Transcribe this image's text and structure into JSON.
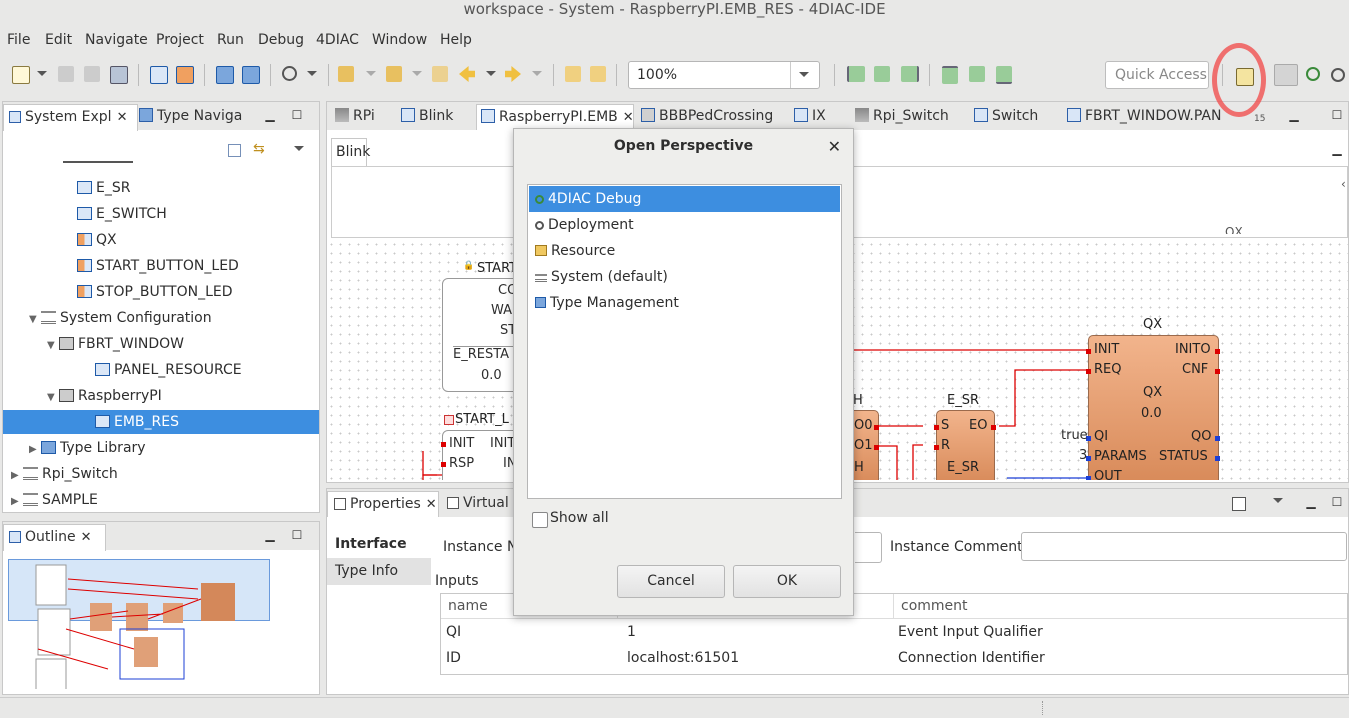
{
  "window": {
    "title": "workspace - System - RaspberryPI.EMB_RES - 4DIAC-IDE"
  },
  "menu": [
    "File",
    "Edit",
    "Navigate",
    "Project",
    "Run",
    "Debug",
    "4DIAC",
    "Window",
    "Help"
  ],
  "toolbar": {
    "zoom": "100%",
    "quick_access_placeholder": "Quick Access"
  },
  "left_panel": {
    "tabs": [
      {
        "label": "System Expl",
        "close": "✕"
      },
      {
        "label": "Type Naviga"
      }
    ],
    "tree": [
      {
        "label": "E_SR",
        "indent": 3,
        "icon": "fb"
      },
      {
        "label": "E_SWITCH",
        "indent": 3,
        "icon": "fb"
      },
      {
        "label": "QX",
        "indent": 3,
        "icon": "fbc"
      },
      {
        "label": "START_BUTTON_LED",
        "indent": 3,
        "icon": "fbc"
      },
      {
        "label": "STOP_BUTTON_LED",
        "indent": 3,
        "icon": "fbc"
      },
      {
        "label": "System Configuration",
        "indent": 1,
        "icon": "sys",
        "twisty": "▼"
      },
      {
        "label": "FBRT_WINDOW",
        "indent": 2,
        "icon": "dev",
        "twisty": "▼"
      },
      {
        "label": "PANEL_RESOURCE",
        "indent": 4,
        "icon": "fb"
      },
      {
        "label": "RaspberryPI",
        "indent": 2,
        "icon": "dev",
        "twisty": "▼"
      },
      {
        "label": "EMB_RES",
        "indent": 4,
        "icon": "fb",
        "selected": true
      },
      {
        "label": "Type Library",
        "indent": 1,
        "icon": "lib",
        "twisty": "▶"
      },
      {
        "label": "Rpi_Switch",
        "indent": 0,
        "icon": "sys",
        "twisty": "▶"
      },
      {
        "label": "SAMPLE",
        "indent": 0,
        "icon": "sys",
        "twisty": "▶"
      }
    ]
  },
  "outline_panel": {
    "tab": "Outline",
    "close": "✕"
  },
  "editor_tabs": [
    {
      "label": "RPi"
    },
    {
      "label": "Blink"
    },
    {
      "label": "RaspberryPI.EMB",
      "active": true,
      "close": "✕"
    },
    {
      "label": "BBBPedCrossing"
    },
    {
      "label": "IX"
    },
    {
      "label": "Rpi_Switch"
    },
    {
      "label": "Switch"
    },
    {
      "label": "FBRT_WINDOW.PAN"
    }
  ],
  "editor_overflow": "15",
  "editor": {
    "subtab": "Blink",
    "canvas_cut_label": "QX",
    "fb_start": {
      "name": "START",
      "lines": [
        "CO",
        "WA",
        "ST"
      ],
      "port": "E_RESTA",
      "value": "0.0"
    },
    "fb_start_led": {
      "name": "START_L",
      "in_ports": [
        "INIT",
        "RSP"
      ],
      "out_ports": [
        "INIT",
        "IN"
      ]
    },
    "fb_switch": {
      "partial": "H",
      "ports": [
        "O0",
        "O1",
        "H"
      ]
    },
    "fb_esr": {
      "title": "E_SR",
      "inputs": [
        "S",
        "R"
      ],
      "output": "EO",
      "type": "E_SR"
    },
    "fb_qx": {
      "title": "QX",
      "type": "QX",
      "version": "0.0",
      "ev_in": [
        "INIT",
        "REQ"
      ],
      "ev_out": [
        "INITO",
        "CNF"
      ],
      "data_in": [
        "QI",
        "PARAMS",
        "OUT"
      ],
      "data_out": [
        "QO",
        "STATUS"
      ],
      "qi_value": "true",
      "params_value": "3"
    }
  },
  "bottom_panel": {
    "tabs": [
      {
        "label": "Properties",
        "close": "✕"
      },
      {
        "label": "Virtual D"
      }
    ],
    "side_tabs": [
      "Interface",
      "Type Info"
    ],
    "instance_name_label": "Instance Na",
    "instance_comment_label": "Instance Comment:",
    "inputs_label": "Inputs",
    "columns": [
      "name",
      "",
      "comment"
    ],
    "rows": [
      {
        "name": "QI",
        "value": "1",
        "comment": "Event Input Qualifier"
      },
      {
        "name": "ID",
        "value": "localhost:61501",
        "comment": "Connection Identifier"
      }
    ]
  },
  "dialog": {
    "title": "Open Perspective",
    "close": "✕",
    "perspectives": [
      {
        "label": "4DIAC Debug",
        "icon": "debug-perspective-icon",
        "selected": true
      },
      {
        "label": "Deployment",
        "icon": "deployment-perspective-icon"
      },
      {
        "label": "Resource",
        "icon": "resource-perspective-icon"
      },
      {
        "label": "System (default)",
        "icon": "system-perspective-icon"
      },
      {
        "label": "Type Management",
        "icon": "type-management-perspective-icon"
      }
    ],
    "show_all": "Show all",
    "cancel": "Cancel",
    "ok": "OK"
  },
  "colors": {
    "selection": "#3d8ee0",
    "fb_fill": "#e8a07a",
    "event_line": "#d00000",
    "data_line": "#1b3fd6",
    "annotation": "#f05050"
  }
}
